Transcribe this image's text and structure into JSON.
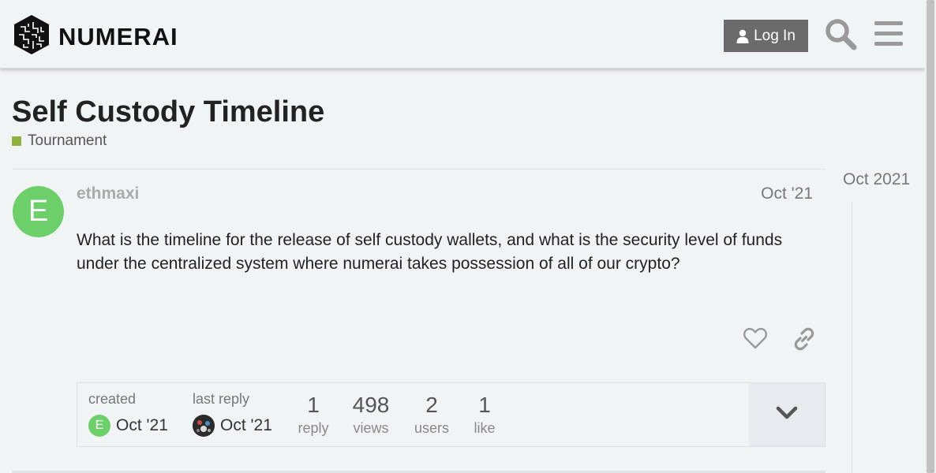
{
  "header": {
    "brand_name": "NUMERAI",
    "login_label": "Log In",
    "icons": {
      "logo": "numerai-cube-logo",
      "user": "user-icon",
      "search": "search-icon",
      "menu": "hamburger-menu-icon"
    }
  },
  "topic": {
    "title": "Self Custody Timeline",
    "category": "Tournament",
    "category_color": "#8fb33e"
  },
  "post": {
    "avatar_letter": "E",
    "avatar_color": "#6ccf6a",
    "username": "ethmaxi",
    "date": "Oct '21",
    "body": "What is the timeline for the release of self custody wallets, and what is the security level of funds under the centralized system where numerai takes possession of all of our crypto?",
    "actions": [
      "heart-icon",
      "link-icon"
    ]
  },
  "summary": {
    "created_label": "created",
    "created_date": "Oct '21",
    "created_avatar_letter": "E",
    "last_reply_label": "last reply",
    "last_reply_date": "Oct '21",
    "stats": [
      {
        "value": "1",
        "label": "reply"
      },
      {
        "value": "498",
        "label": "views"
      },
      {
        "value": "2",
        "label": "users"
      },
      {
        "value": "1",
        "label": "like"
      }
    ]
  },
  "timeline": {
    "date": "Oct 2021"
  }
}
